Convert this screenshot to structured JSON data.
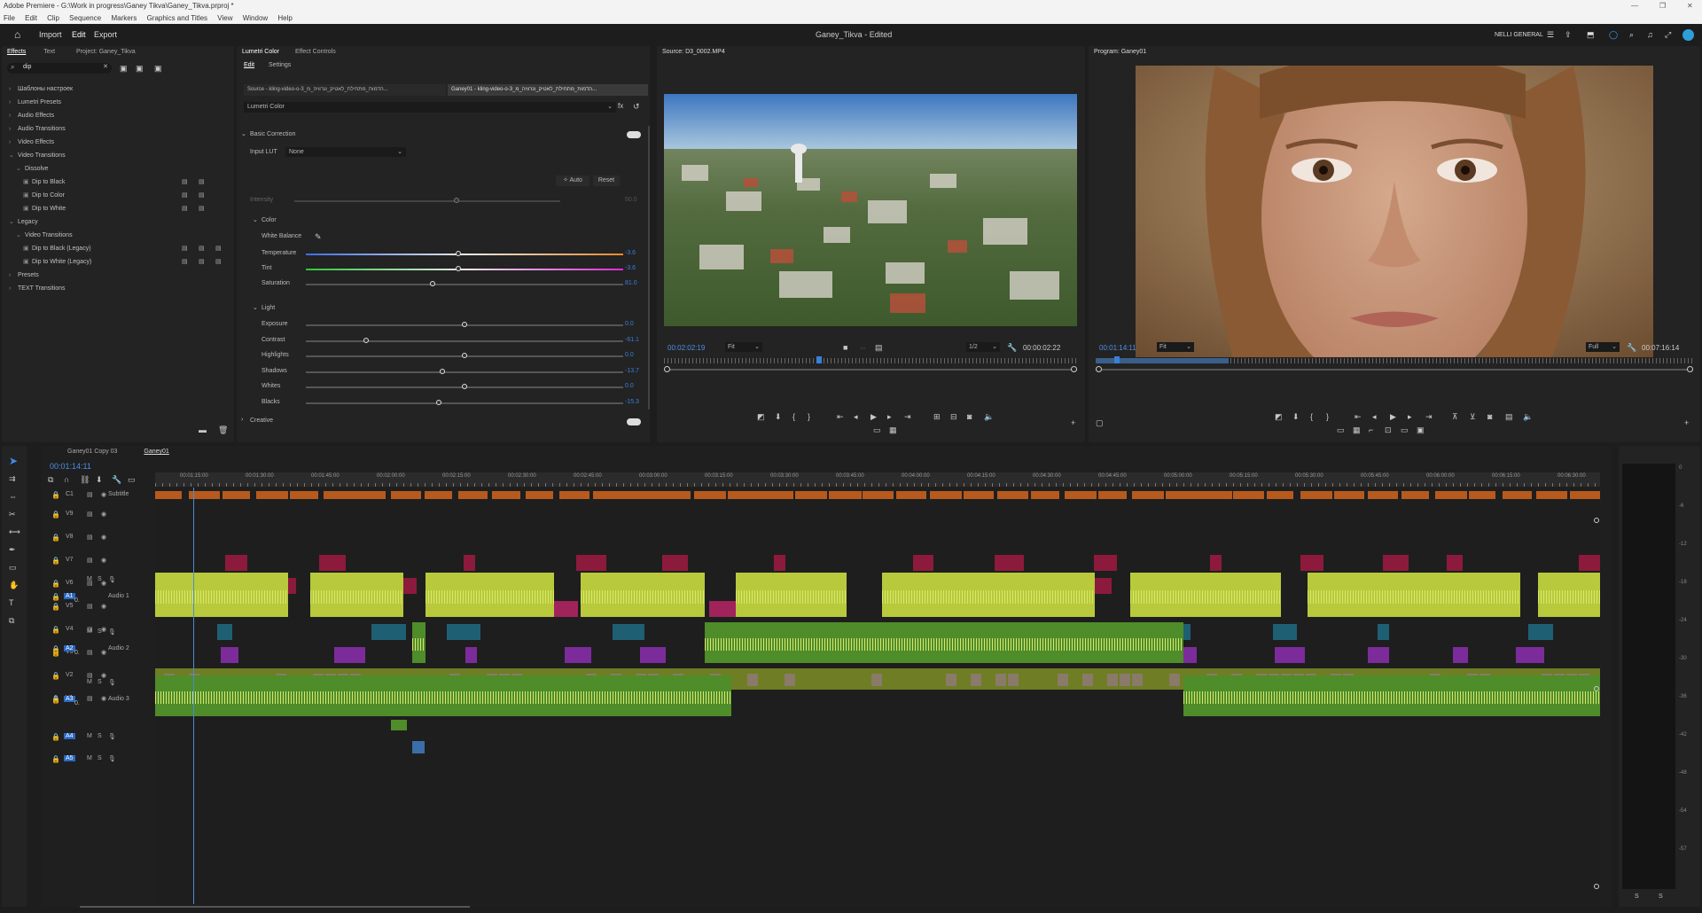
{
  "titlebar": {
    "title": "Adobe Premiere - G:\\Work in progress\\Ganey Tikva\\Ganey_Tikva.prproj *"
  },
  "menu": [
    "File",
    "Edit",
    "Clip",
    "Sequence",
    "Markers",
    "Graphics and Titles",
    "View",
    "Window",
    "Help"
  ],
  "header": {
    "tabs": [
      "Import",
      "Edit",
      "Export"
    ],
    "project_title": "Ganey_Tikva - Edited",
    "workspace": "NELLI GENERAL"
  },
  "effects_panel": {
    "tabs": [
      "Effects",
      "Text",
      "Project: Ganey_Tikva"
    ],
    "search_value": "dip",
    "tree": [
      {
        "label": "Шаблоны настроек",
        "depth": 0,
        "open": false
      },
      {
        "label": "Lumetri Presets",
        "depth": 0,
        "open": false
      },
      {
        "label": "Audio Effects",
        "depth": 0,
        "open": false
      },
      {
        "label": "Audio Transitions",
        "depth": 0,
        "open": false
      },
      {
        "label": "Video Effects",
        "depth": 0,
        "open": false
      },
      {
        "label": "Video Transitions",
        "depth": 0,
        "open": true
      },
      {
        "label": "Dissolve",
        "depth": 1,
        "open": true
      },
      {
        "label": "Dip to Black",
        "depth": 2,
        "item": true
      },
      {
        "label": "Dip to Color",
        "depth": 2,
        "item": true
      },
      {
        "label": "Dip to White",
        "depth": 2,
        "item": true
      },
      {
        "label": "Legacy",
        "depth": 0,
        "open": true
      },
      {
        "label": "Video Transitions",
        "depth": 1,
        "open": true
      },
      {
        "label": "Dip to Black (Legacy)",
        "depth": 2,
        "item": true
      },
      {
        "label": "Dip to White (Legacy)",
        "depth": 2,
        "item": true
      },
      {
        "label": "Presets",
        "depth": 0,
        "open": false
      },
      {
        "label": "TEXT Transitions",
        "depth": 0,
        "open": false
      }
    ]
  },
  "lumetri": {
    "tabs": [
      "Lumetri Color",
      "Effect Controls"
    ],
    "subtabs": [
      "Edit",
      "Settings"
    ],
    "source_tab": "Source - kling-video-o-3_הדמות_מתחילת_לאטיק_ונרוויה_מ...",
    "seq_tab": "Ganey01 - kling-video-o-3_הדמות_מתחילת_לאטיק_ונרוויה_מ...",
    "effect_select": "Lumetri Color",
    "basic_correction": "Basic Correction",
    "input_lut_label": "Input LUT",
    "input_lut_value": "None",
    "auto": "Auto",
    "reset": "Reset",
    "intensity_label": "Intensity",
    "intensity_value": "50.0",
    "color_section": "Color",
    "white_balance": "White Balance",
    "color_sliders": [
      {
        "label": "Temperature",
        "value": "-3.6",
        "pos": 0.48
      },
      {
        "label": "Tint",
        "value": "-3.6",
        "pos": 0.48
      },
      {
        "label": "Saturation",
        "value": "81.0",
        "pos": 0.4
      }
    ],
    "light_section": "Light",
    "light_sliders": [
      {
        "label": "Exposure",
        "value": "0.0",
        "pos": 0.5
      },
      {
        "label": "Contrast",
        "value": "-61.1",
        "pos": 0.19
      },
      {
        "label": "Highlights",
        "value": "0.0",
        "pos": 0.5
      },
      {
        "label": "Shadows",
        "value": "-13.7",
        "pos": 0.43
      },
      {
        "label": "Whites",
        "value": "0.0",
        "pos": 0.5
      },
      {
        "label": "Blacks",
        "value": "-15.3",
        "pos": 0.42
      }
    ],
    "creative": "Creative"
  },
  "source_monitor": {
    "tab": "Source: D3_0002.MP4",
    "timecode": "00:02:02:19",
    "fit": "Fit",
    "resolution": "1/2",
    "duration": "00:00:02:22"
  },
  "program_monitor": {
    "tab": "Program: Ganey01",
    "timecode": "00:01:14:11",
    "fit": "Fit",
    "resolution": "Full",
    "duration": "00:07:16:14"
  },
  "timeline": {
    "tabs": [
      "Ganey01 Copy 03",
      "Ganey01"
    ],
    "timecode": "00:01:14:11",
    "ruler": [
      "00:01:15:00",
      "00:01:30:00",
      "00:01:45:00",
      "00:02:00:00",
      "00:02:15:00",
      "00:02:30:00",
      "00:02:45:00",
      "00:03:00:00",
      "00:03:15:00",
      "00:03:30:00",
      "00:03:45:00",
      "00:04:00:00",
      "00:04:15:00",
      "00:04:30:00",
      "00:04:45:00",
      "00:05:00:00",
      "00:05:15:00",
      "00:05:30:00",
      "00:05:45:00",
      "00:06:00:00",
      "00:06:15:00",
      "00:06:30:00"
    ],
    "subtitle_track": "Subtitle",
    "video_tracks": [
      "V9",
      "V8",
      "V7",
      "V6",
      "V5",
      "V4",
      "V3",
      "V2",
      "V1"
    ],
    "audio_tracks": [
      {
        "id": "A1",
        "name": "Audio 1"
      },
      {
        "id": "A2",
        "name": "Audio 2"
      },
      {
        "id": "A3",
        "name": "Audio 3"
      },
      {
        "id": "A4",
        "name": ""
      },
      {
        "id": "A5",
        "name": ""
      }
    ],
    "audio_level": "0.",
    "audio_meter_scale": [
      "0",
      "-6",
      "-12",
      "-18",
      "-24",
      "-30",
      "-36",
      "-42",
      "-48",
      "-54",
      "-57"
    ],
    "meter_footer": [
      "S",
      "S"
    ]
  },
  "colors": {
    "accent": "#2d8ceb",
    "audio_clip": "#8db83a",
    "video_teal": "#1f5f73",
    "video_purple": "#7b2c9a",
    "video_red": "#8c1a3c",
    "subtitle": "#b65a1e"
  }
}
